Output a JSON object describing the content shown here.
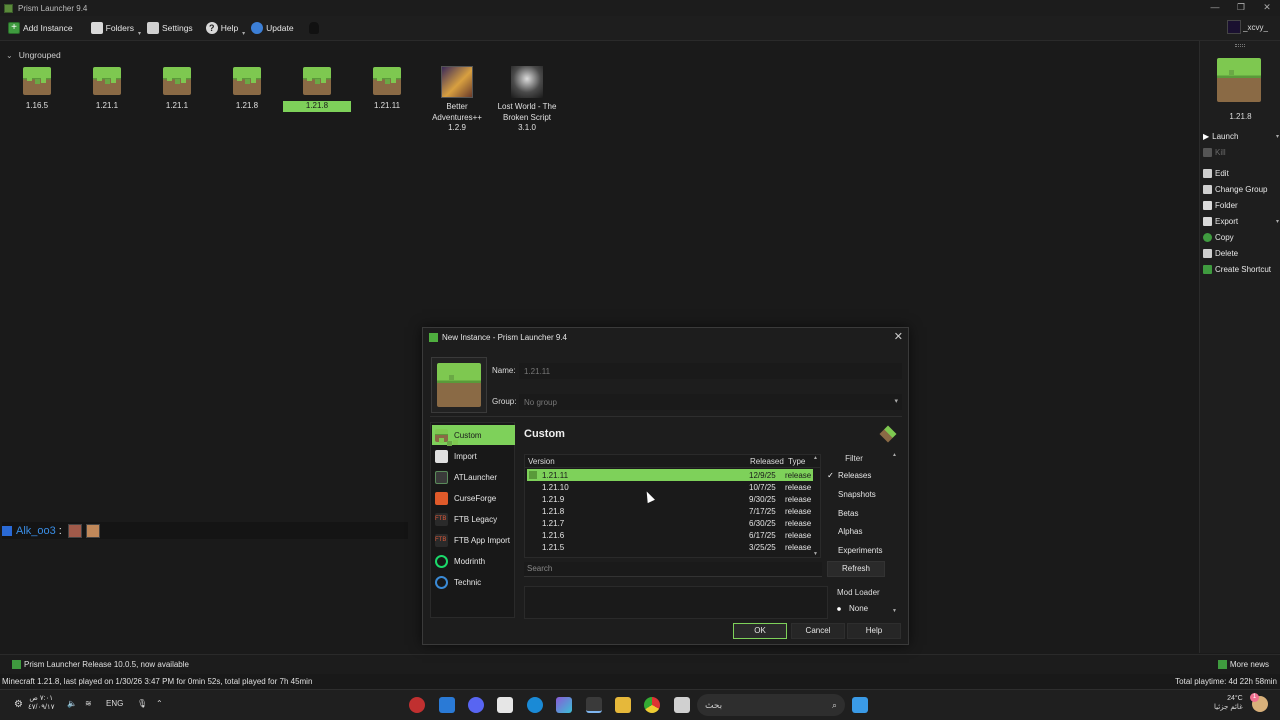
{
  "window": {
    "title": "Prism Launcher 9.4",
    "controls": [
      "—",
      "❐",
      "✕"
    ]
  },
  "toolbar": {
    "add_instance": "Add Instance",
    "folders": "Folders",
    "settings": "Settings",
    "help": "Help",
    "update": "Update",
    "account": "_xcvy_"
  },
  "group": {
    "name": "Ungrouped"
  },
  "instances": [
    {
      "name": "1.16.5"
    },
    {
      "name": "1.21.1"
    },
    {
      "name": "1.21.1"
    },
    {
      "name": "1.21.8"
    },
    {
      "name": "1.21.8",
      "selected": true
    },
    {
      "name": "1.21.11"
    },
    {
      "name": "Better Adventures++ 1.2.9"
    },
    {
      "name": "Lost World - The Broken Script 3.1.0"
    }
  ],
  "side_panel": {
    "selected_instance": "1.21.8",
    "actions": {
      "launch": "Launch",
      "kill": "Kill",
      "edit": "Edit",
      "change_group": "Change Group",
      "folder": "Folder",
      "export": "Export",
      "copy": "Copy",
      "delete": "Delete",
      "create_shortcut": "Create Shortcut"
    }
  },
  "chat": {
    "user": "Alk_oo3",
    "separator": ":"
  },
  "status": {
    "news": "Prism Launcher Release 10.0.5, now available",
    "more_news": "More news",
    "last_played": "Minecraft 1.21.8, last played on 1/30/26 3:47 PM for 0min 52s, total played for 7h 45min",
    "total_playtime": "Total playtime: 4d 22h 58min"
  },
  "dialog": {
    "title": "New Instance - Prism Launcher 9.4",
    "name_label": "Name:",
    "name_value": "1.21.11",
    "group_label": "Group:",
    "group_placeholder": "No group",
    "sources": [
      "Custom",
      "Import",
      "ATLauncher",
      "CurseForge",
      "FTB Legacy",
      "FTB App Import",
      "Modrinth",
      "Technic"
    ],
    "page_title": "Custom",
    "columns": {
      "version": "Version",
      "released": "Released",
      "type": "Type"
    },
    "versions": [
      {
        "version": "1.21.11",
        "released": "12/9/25",
        "type": "release",
        "selected": true
      },
      {
        "version": "1.21.10",
        "released": "10/7/25",
        "type": "release"
      },
      {
        "version": "1.21.9",
        "released": "9/30/25",
        "type": "release"
      },
      {
        "version": "1.21.8",
        "released": "7/17/25",
        "type": "release"
      },
      {
        "version": "1.21.7",
        "released": "6/30/25",
        "type": "release"
      },
      {
        "version": "1.21.6",
        "released": "6/17/25",
        "type": "release"
      },
      {
        "version": "1.21.5",
        "released": "3/25/25",
        "type": "release"
      }
    ],
    "filter": {
      "title": "Filter",
      "options": [
        {
          "label": "Releases",
          "checked": true
        },
        {
          "label": "Snapshots",
          "checked": false
        },
        {
          "label": "Betas",
          "checked": false
        },
        {
          "label": "Alphas",
          "checked": false
        },
        {
          "label": "Experiments",
          "checked": false
        }
      ]
    },
    "search_placeholder": "Search",
    "refresh": "Refresh",
    "mod_loader": {
      "title": "Mod Loader",
      "selected": "None"
    },
    "buttons": {
      "ok": "OK",
      "cancel": "Cancel",
      "help": "Help"
    }
  },
  "taskbar": {
    "time": "٧:٠١ ص",
    "date": "٤٧/٠٩/١٧",
    "lang": "ENG",
    "search_placeholder": "بحث",
    "weather_temp": "24°C",
    "weather_desc": "غائم جزئيا",
    "notif_count": "1"
  }
}
